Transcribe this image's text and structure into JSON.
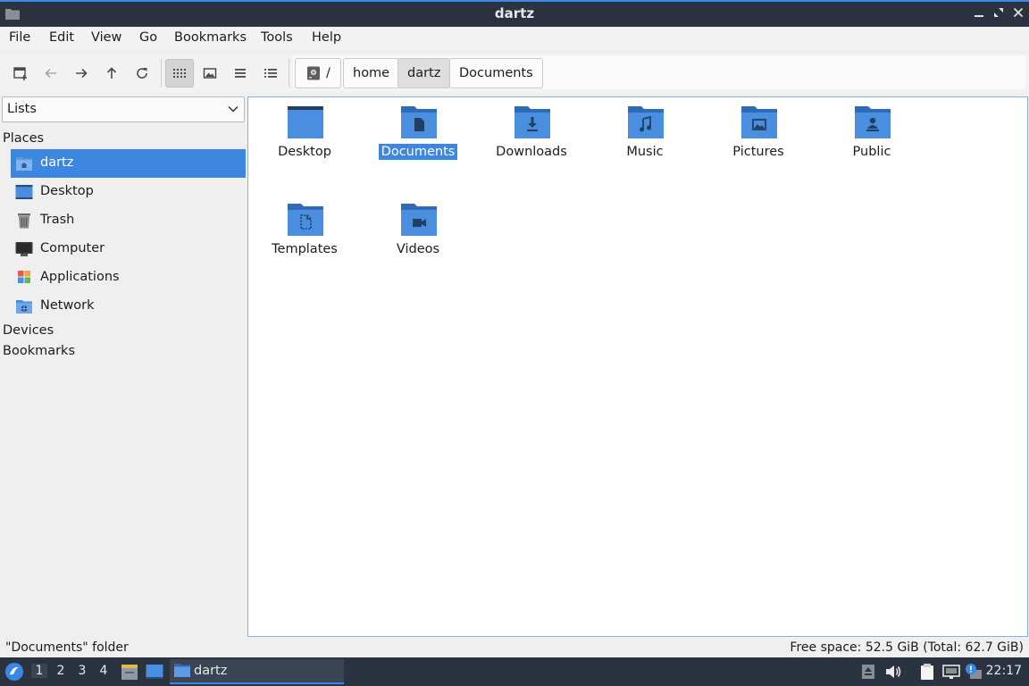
{
  "window": {
    "title": "dartz"
  },
  "menu": [
    "File",
    "Edit",
    "View",
    "Go",
    "Bookmarks",
    "Tools",
    "Help"
  ],
  "toolbar": {
    "buttons": [
      "new-window-icon",
      "back-icon",
      "forward-icon",
      "up-icon",
      "reload-icon",
      "icon-view-icon",
      "thumbnail-view-icon",
      "compact-view-icon",
      "detailed-list-view-icon"
    ],
    "active_view": "icon-view"
  },
  "breadcrumb": {
    "root": "/",
    "items": [
      "home",
      "dartz",
      "Documents"
    ],
    "current": "dartz"
  },
  "sidebar": {
    "combo_value": "Lists",
    "places_header": "Places",
    "places": [
      {
        "label": "dartz",
        "icon": "home-folder-icon",
        "selected": true
      },
      {
        "label": "Desktop",
        "icon": "desktop-icon"
      },
      {
        "label": "Trash",
        "icon": "trash-icon"
      },
      {
        "label": "Computer",
        "icon": "computer-icon"
      },
      {
        "label": "Applications",
        "icon": "applications-icon"
      },
      {
        "label": "Network",
        "icon": "network-icon"
      }
    ],
    "devices_header": "Devices",
    "bookmarks_header": "Bookmarks"
  },
  "files": [
    {
      "label": "Desktop",
      "icon": "desktop-folder-icon"
    },
    {
      "label": "Documents",
      "icon": "documents-folder-icon",
      "selected": true
    },
    {
      "label": "Downloads",
      "icon": "downloads-folder-icon"
    },
    {
      "label": "Music",
      "icon": "music-folder-icon"
    },
    {
      "label": "Pictures",
      "icon": "pictures-folder-icon"
    },
    {
      "label": "Public",
      "icon": "public-folder-icon"
    },
    {
      "label": "Templates",
      "icon": "templates-folder-icon"
    },
    {
      "label": "Videos",
      "icon": "videos-folder-icon"
    }
  ],
  "status": {
    "left": "\"Documents\" folder",
    "right": "Free space: 52.5 GiB (Total: 62.7 GiB)"
  },
  "taskbar": {
    "workspaces": [
      "1",
      "2",
      "3",
      "4"
    ],
    "active_workspace": "1",
    "task_label": "dartz",
    "clock": "22:17"
  },
  "colors": {
    "accent": "#3d87e1",
    "folder": "#4a8ee0",
    "folder_dark": "#2f6bb8",
    "titlebar": "#2b3340"
  }
}
